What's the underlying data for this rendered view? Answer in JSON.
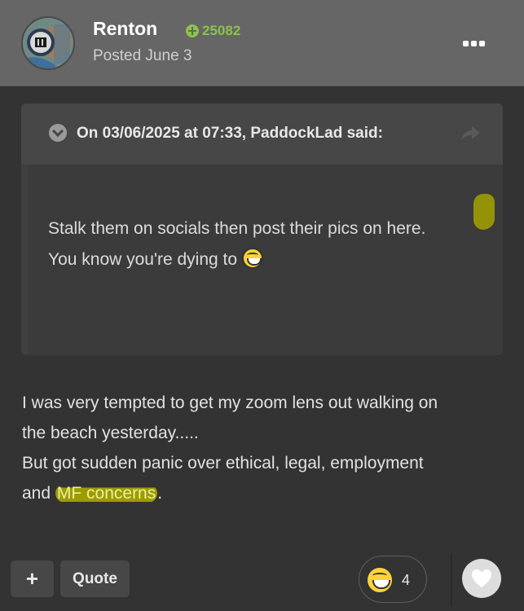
{
  "post": {
    "author": "Renton",
    "reputation": "25082",
    "posted": "Posted June 3",
    "colors": {
      "reputation": "#8bc34a",
      "highlight": "#9d9b00"
    }
  },
  "quote": {
    "cite": "On 03/06/2025 at 07:33, PaddockLad said:",
    "line1": "Stalk them on socials then post their pics on here.",
    "line2": "You know you're dying to"
  },
  "body": {
    "line1": "I was very tempted to get my zoom lens out walking on",
    "line2": "the beach yesterday.....",
    "line3": "But got sudden panic over ethical, legal, employment",
    "line4_prefix": "and ",
    "line4_highlight": "MF concerns",
    "line4_suffix": "."
  },
  "footer": {
    "plus_label": "+",
    "quote_label": "Quote",
    "reaction_count": "4"
  },
  "icons": [
    "avatar",
    "reputation-plus-icon",
    "more-options-icon",
    "chevron-down-icon",
    "share-icon",
    "grin-emoji-icon",
    "heart-icon"
  ]
}
